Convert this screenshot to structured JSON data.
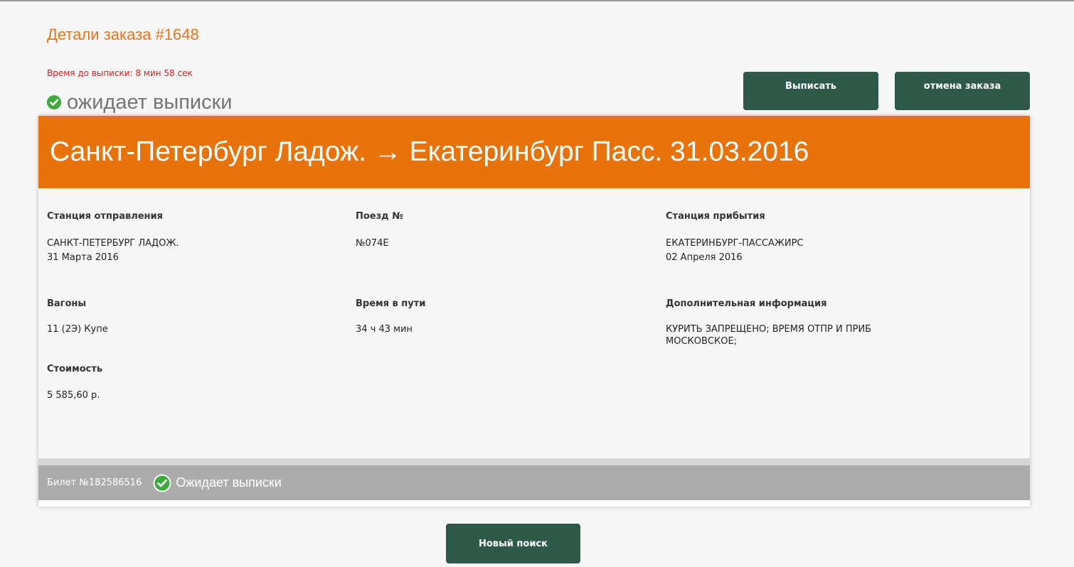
{
  "order": {
    "title": "Детали заказа #1648",
    "timer_text": "Время до выписки: 8 мин 58 сек",
    "status_text": "ожидает выписки",
    "status_icon": "check-circle-icon"
  },
  "actions": {
    "issue_label": "Выписать",
    "cancel_label": "отмена заказа",
    "new_search_label": "Новый поиск"
  },
  "route": {
    "title": "Санкт-Петербург Ладож. → Екатеринбург Пасс. 31.03.2016"
  },
  "details": {
    "departure": {
      "label": "Станция отправления",
      "station": "САНКТ-ПЕТЕРБУРГ ЛАДОЖ.",
      "date": "31 Марта 2016"
    },
    "train": {
      "label": "Поезд №",
      "number": "№074Е"
    },
    "arrival": {
      "label": "Станция прибытия",
      "station": "ЕКАТЕРИНБУРГ-ПАССАЖИРС",
      "date": "02 Апреля 2016"
    },
    "cars": {
      "label": "Вагоны",
      "value": "11 (2Э) Купе"
    },
    "travel_time": {
      "label": "Время в пути",
      "value": "34 ч 43 мин"
    },
    "extra_info": {
      "label": "Дополнительная информация",
      "line1": "КУРИТЬ ЗАПРЕЩЕНО; ВРЕМЯ ОТПР И ПРИБ",
      "line2": "МОСКОВСКОЕ;"
    },
    "price": {
      "label": "Стоимость",
      "value": "5 585,60 р."
    }
  },
  "ticket": {
    "number_text": "Билет №182586516",
    "status_text": "Ожидает выписки",
    "status_icon": "check-circle-icon"
  },
  "colors": {
    "accent_orange": "#e8730b",
    "button_green": "#2e5948",
    "success_green": "#3bab3b",
    "timer_red": "#d4201f",
    "ticket_bar_gray": "#acacac"
  }
}
